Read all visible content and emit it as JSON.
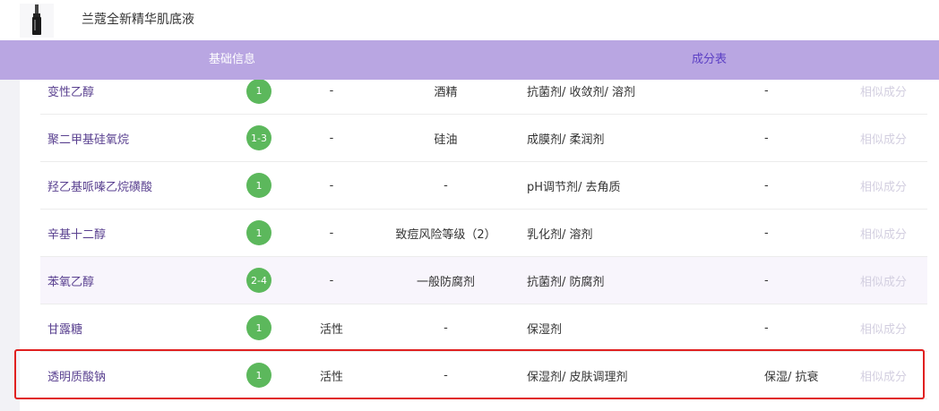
{
  "product": {
    "title": "兰蔻全新精华肌底液",
    "thumb_icon": "serum-bottle-icon"
  },
  "header": {
    "basic_info": "基础信息",
    "ingredients": "成分表"
  },
  "colors": {
    "header_bg": "#b9a6e2",
    "badge_green": "#5cb85c",
    "selection_red": "#e02020"
  },
  "rows": [
    {
      "name": "变性乙醇",
      "score": "1",
      "active": "-",
      "risk": "酒精",
      "purpose": "抗菌剂/ 收敛剂/ 溶剂",
      "effect": "-",
      "similar": "相似成分"
    },
    {
      "name": "聚二甲基硅氧烷",
      "score": "1-3",
      "active": "-",
      "risk": "硅油",
      "purpose": "成膜剂/ 柔润剂",
      "effect": "-",
      "similar": "相似成分"
    },
    {
      "name": "羟乙基哌嗪乙烷磺酸",
      "score": "1",
      "active": "-",
      "risk": "-",
      "purpose": "pH调节剂/ 去角质",
      "effect": "-",
      "similar": "相似成分"
    },
    {
      "name": "辛基十二醇",
      "score": "1",
      "active": "-",
      "risk": "致痘风险等级（2）",
      "purpose": "乳化剂/ 溶剂",
      "effect": "-",
      "similar": "相似成分"
    },
    {
      "name": "苯氧乙醇",
      "score": "2-4",
      "active": "-",
      "risk": "一般防腐剂",
      "purpose": "抗菌剂/ 防腐剂",
      "effect": "-",
      "similar": "相似成分"
    },
    {
      "name": "甘露糖",
      "score": "1",
      "active": "活性",
      "risk": "-",
      "purpose": "保湿剂",
      "effect": "-",
      "similar": "相似成分"
    },
    {
      "name": "透明质酸钠",
      "score": "1",
      "active": "活性",
      "risk": "-",
      "purpose": "保湿剂/ 皮肤调理剂",
      "effect": "保湿/ 抗衰",
      "similar": "相似成分"
    }
  ]
}
